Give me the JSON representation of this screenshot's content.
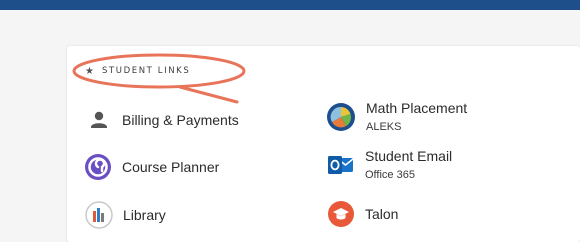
{
  "section": {
    "title": "STUDENT LINKS",
    "icon": "star-icon"
  },
  "links": [
    {
      "label": "Billing & Payments",
      "icon": "person-icon"
    },
    {
      "label": "Math Placement",
      "sub": "ALEKS",
      "icon": "aleks-icon"
    },
    {
      "label": "Course Planner",
      "icon": "course-planner-icon"
    },
    {
      "label": "Student Email",
      "sub": "Office 365",
      "icon": "outlook-icon"
    },
    {
      "label": "Library",
      "icon": "library-icon"
    },
    {
      "label": "Talon",
      "icon": "talon-icon"
    }
  ],
  "colors": {
    "header_bar": "#1f4f8a",
    "annotation": "#e8745a",
    "course_planner": "#6a4fc4",
    "outlook": "#0f5ba8",
    "talon": "#e8593a"
  }
}
